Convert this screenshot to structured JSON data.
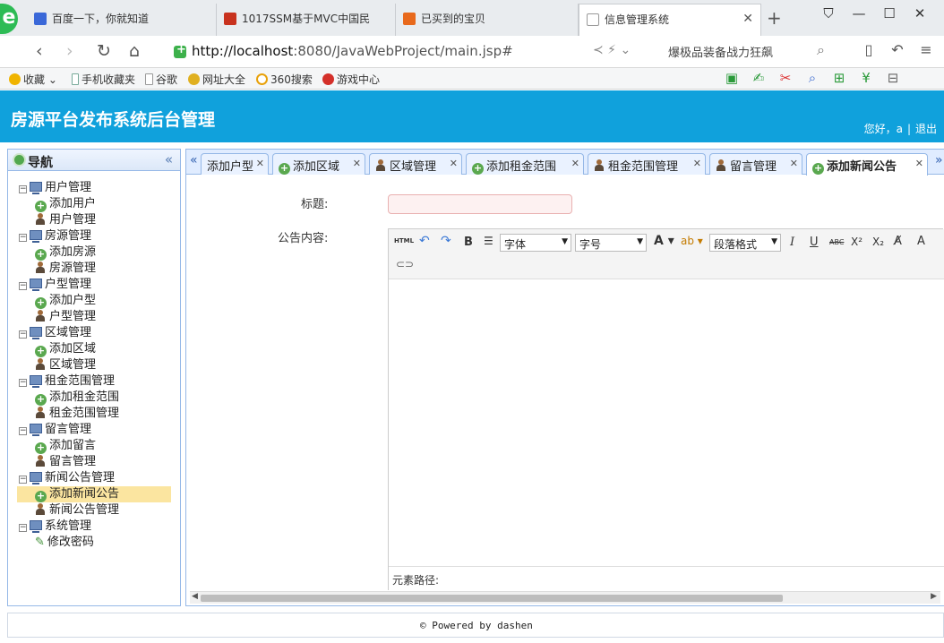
{
  "browser": {
    "tabs": [
      {
        "title": "百度一下，你就知道"
      },
      {
        "title": "1017SSM基于MVC中国民"
      },
      {
        "title": "已买到的宝贝"
      },
      {
        "title": "信息管理系统",
        "active": true
      }
    ],
    "url_host": "http://localhost",
    "url_rest": ":8080/JavaWebProject/main.jsp#",
    "search_hint": "爆极品装备战力狂飙"
  },
  "bookmarks": [
    "收藏",
    "手机收藏夹",
    "谷歌",
    "网址大全",
    "360搜索",
    "游戏中心"
  ],
  "app": {
    "title": "房源平台发布系统后台管理",
    "greeting": "您好，a",
    "separator": "|",
    "logout": "退出"
  },
  "sidebar": {
    "title": "导航",
    "groups": [
      {
        "label": "用户管理",
        "items": [
          {
            "label": "添加用户",
            "icon": "add"
          },
          {
            "label": "用户管理",
            "icon": "user"
          }
        ]
      },
      {
        "label": "房源管理",
        "items": [
          {
            "label": "添加房源",
            "icon": "add"
          },
          {
            "label": "房源管理",
            "icon": "user"
          }
        ]
      },
      {
        "label": "户型管理",
        "items": [
          {
            "label": "添加户型",
            "icon": "add"
          },
          {
            "label": "户型管理",
            "icon": "user"
          }
        ]
      },
      {
        "label": "区域管理",
        "items": [
          {
            "label": "添加区域",
            "icon": "add"
          },
          {
            "label": "区域管理",
            "icon": "user"
          }
        ]
      },
      {
        "label": "租金范围管理",
        "items": [
          {
            "label": "添加租金范围",
            "icon": "add"
          },
          {
            "label": "租金范围管理",
            "icon": "user"
          }
        ]
      },
      {
        "label": "留言管理",
        "items": [
          {
            "label": "添加留言",
            "icon": "add"
          },
          {
            "label": "留言管理",
            "icon": "user"
          }
        ]
      },
      {
        "label": "新闻公告管理",
        "items": [
          {
            "label": "添加新闻公告",
            "icon": "add",
            "selected": true
          },
          {
            "label": "新闻公告管理",
            "icon": "user"
          }
        ]
      },
      {
        "label": "系统管理",
        "items": [
          {
            "label": "修改密码",
            "icon": "pen"
          }
        ]
      }
    ]
  },
  "tabs": [
    {
      "label": "添加户型",
      "icon": "none"
    },
    {
      "label": "添加区域",
      "icon": "add"
    },
    {
      "label": "区域管理",
      "icon": "user"
    },
    {
      "label": "添加租金范围",
      "icon": "add"
    },
    {
      "label": "租金范围管理",
      "icon": "user"
    },
    {
      "label": "留言管理",
      "icon": "user"
    },
    {
      "label": "添加新闻公告",
      "icon": "add",
      "active": true
    }
  ],
  "form": {
    "title_label": "标题:",
    "content_label": "公告内容:",
    "title_value": ""
  },
  "editor": {
    "html_btn": "HTML",
    "font_family": "字体",
    "font_size": "字号",
    "paragraph": "段落格式",
    "path_label": "元素路径:"
  },
  "footer": {
    "text": "© Powered by dashen"
  }
}
